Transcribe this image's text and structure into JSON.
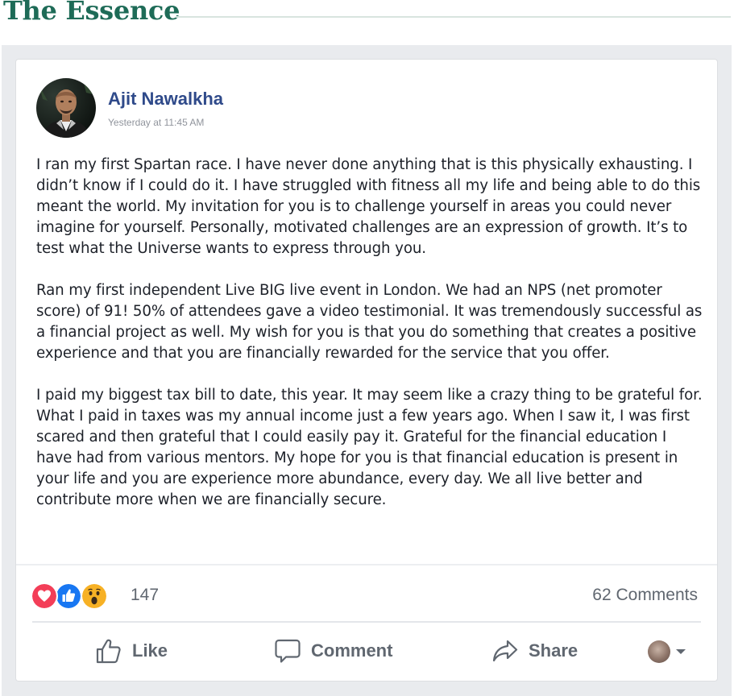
{
  "header": {
    "title": "The Essence"
  },
  "post": {
    "author": "Ajit Nawalkha",
    "timestamp": "Yesterday at 11:45 AM",
    "paragraphs": [
      "I ran my first Spartan race. I have never done anything that is this physically exhausting. I didn’t know if I could do it. I have struggled with fitness all my life and being able to do this meant the world. My invitation for you is to challenge yourself in areas you could never imagine for yourself. Personally, motivated challenges are an expression of growth. It’s to test what the Universe wants to express through you.",
      "Ran my first independent Live BIG live event in London. We had an NPS (net promoter score) of 91! 50% of attendees gave a video testimonial. It was tremendously successful as a financial project as well. My wish for you is that you do something that creates a positive experience and that you are financially rewarded for the service that you offer.",
      "I paid my biggest tax bill to date, this year. It may seem like a crazy thing to be grateful for. What I paid in taxes was my annual income just a few years ago. When I saw it, I was first scared and then grateful that I could easily pay it. Grateful for the financial education I have had from various mentors. My hope for you is that financial education is present in your life and you are experience more abundance, every day. We all live better and contribute more when we are financially secure."
    ]
  },
  "stats": {
    "reaction_count": "147",
    "comments": "62 Comments",
    "reactions": [
      "love-icon",
      "like-icon",
      "wow-icon"
    ]
  },
  "actions": {
    "like": "Like",
    "comment": "Comment",
    "share": "Share"
  },
  "colors": {
    "brand_green": "#1e6b57",
    "author_blue": "#2f4a8a",
    "love_red": "#f33e58",
    "like_blue": "#1877f2",
    "wow_yellow": "#f7b125"
  }
}
